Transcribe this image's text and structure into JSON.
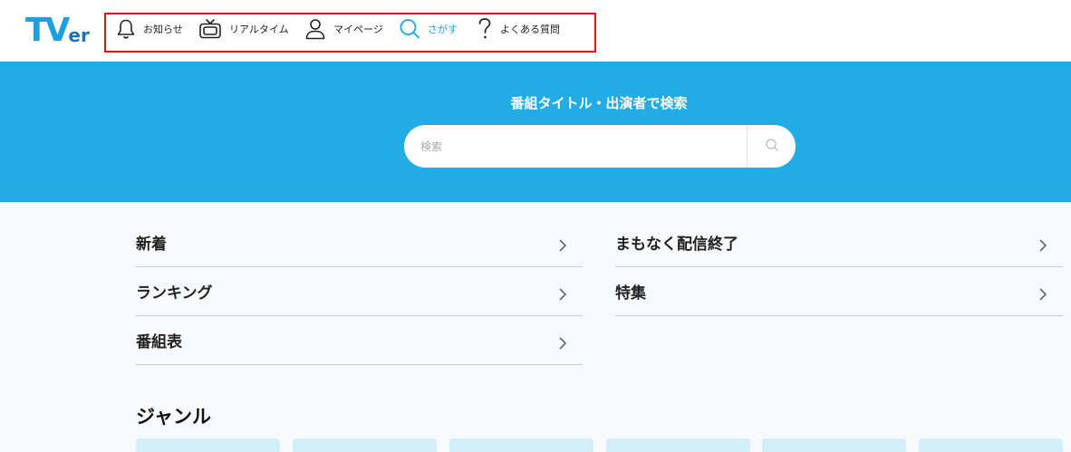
{
  "logo": {
    "big": "TV",
    "small": "er"
  },
  "nav": {
    "items": [
      {
        "label": "お知らせ",
        "icon": "bell-icon"
      },
      {
        "label": "リアルタイム",
        "icon": "tv-icon"
      },
      {
        "label": "マイページ",
        "icon": "person-icon"
      },
      {
        "label": "さがす",
        "icon": "search-icon",
        "active": true
      },
      {
        "label": "よくある質問",
        "icon": "question-icon"
      }
    ],
    "active_color": "#1aa6e3"
  },
  "hero": {
    "title": "番組タイトル・出演者で検索",
    "search_placeholder": "検索",
    "background": "#22abe4"
  },
  "menu": {
    "left": [
      "新着",
      "ランキング",
      "番組表"
    ],
    "right": [
      "まもなく配信終了",
      "特集"
    ]
  },
  "genre": {
    "title": "ジャンル"
  },
  "highlight_box_color": "#e0141a"
}
